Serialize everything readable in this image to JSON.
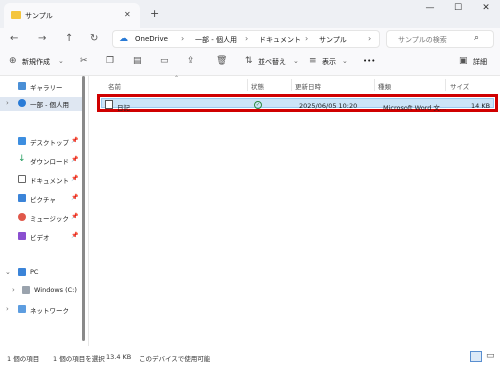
{
  "window": {
    "tab_title": "サンプル",
    "new_tab_icon": "plus-icon",
    "controls": [
      "minimize-icon",
      "maximize-icon",
      "close-icon"
    ]
  },
  "address": {
    "crumbs": [
      "OneDrive",
      "一部 - 個人用",
      "ドキュメント",
      "サンプル"
    ],
    "search_placeholder": "サンプルの検索"
  },
  "commands": {
    "new_label": "新規作成",
    "sort_label": "並べ替え",
    "view_label": "表示",
    "more_label": "•••",
    "details_label": "詳細"
  },
  "sidebar": {
    "gallery": "ギャラリー",
    "onedrive": "一部 - 個人用",
    "desktop": "デスクトップ",
    "downloads": "ダウンロード",
    "documents": "ドキュメント",
    "pictures": "ピクチャ",
    "music": "ミュージック",
    "videos": "ビデオ",
    "pc": "PC",
    "windows_c": "Windows (C:)",
    "network": "ネットワーク"
  },
  "columns": {
    "name": "名前",
    "status": "状態",
    "modified": "更新日時",
    "type": "種類",
    "size": "サイズ"
  },
  "files": [
    {
      "name": "日記",
      "status_icon": "synced-check-icon",
      "modified": "2025/06/05 10:20",
      "type": "Microsoft Word 文...",
      "size": "14 KB"
    }
  ],
  "status": {
    "item_count": "1 個の項目",
    "selected": "1 個の項目を選択",
    "selected_size": "13.4 KB",
    "availability": "このデバイスで使用可能"
  },
  "colors": {
    "selection": "#cce4f7",
    "highlight_border": "#d00000",
    "folder": "#f4c53d"
  }
}
